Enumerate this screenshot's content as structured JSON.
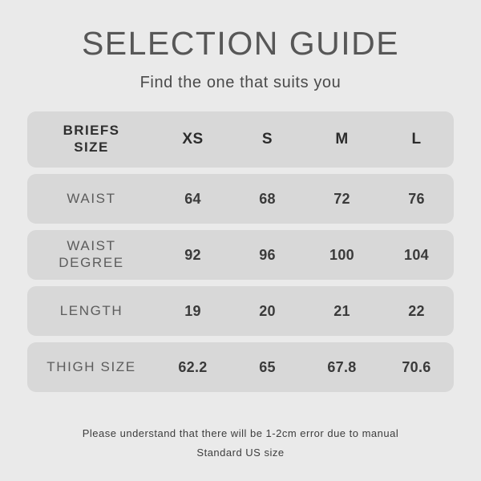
{
  "header": {
    "title": "SELECTION GUIDE",
    "subtitle": "Find the one that suits you"
  },
  "table": {
    "header": {
      "label_line1": "BRIEFS",
      "label_line2": "SIZE",
      "sizes": [
        "XS",
        "S",
        "M",
        "L"
      ]
    },
    "rows": [
      {
        "label_line1": "WAIST",
        "label_line2": "",
        "values": [
          "64",
          "68",
          "72",
          "76"
        ]
      },
      {
        "label_line1": "WAIST",
        "label_line2": "DEGREE",
        "values": [
          "92",
          "96",
          "100",
          "104"
        ]
      },
      {
        "label_line1": "LENGTH",
        "label_line2": "",
        "values": [
          "19",
          "20",
          "21",
          "22"
        ]
      },
      {
        "label_line1": "THIGH SIZE",
        "label_line2": "",
        "values": [
          "62.2",
          "65",
          "67.8",
          "70.6"
        ]
      }
    ]
  },
  "footer": {
    "line1": "Please understand that there will be 1-2cm error due to manual",
    "line2": "Standard US size"
  },
  "colors": {
    "background": "#eaeaea",
    "row_background": "#d8d8d8",
    "title_text": "#575757",
    "value_text": "#3a3a3a",
    "label_text": "#5c5c5c"
  }
}
